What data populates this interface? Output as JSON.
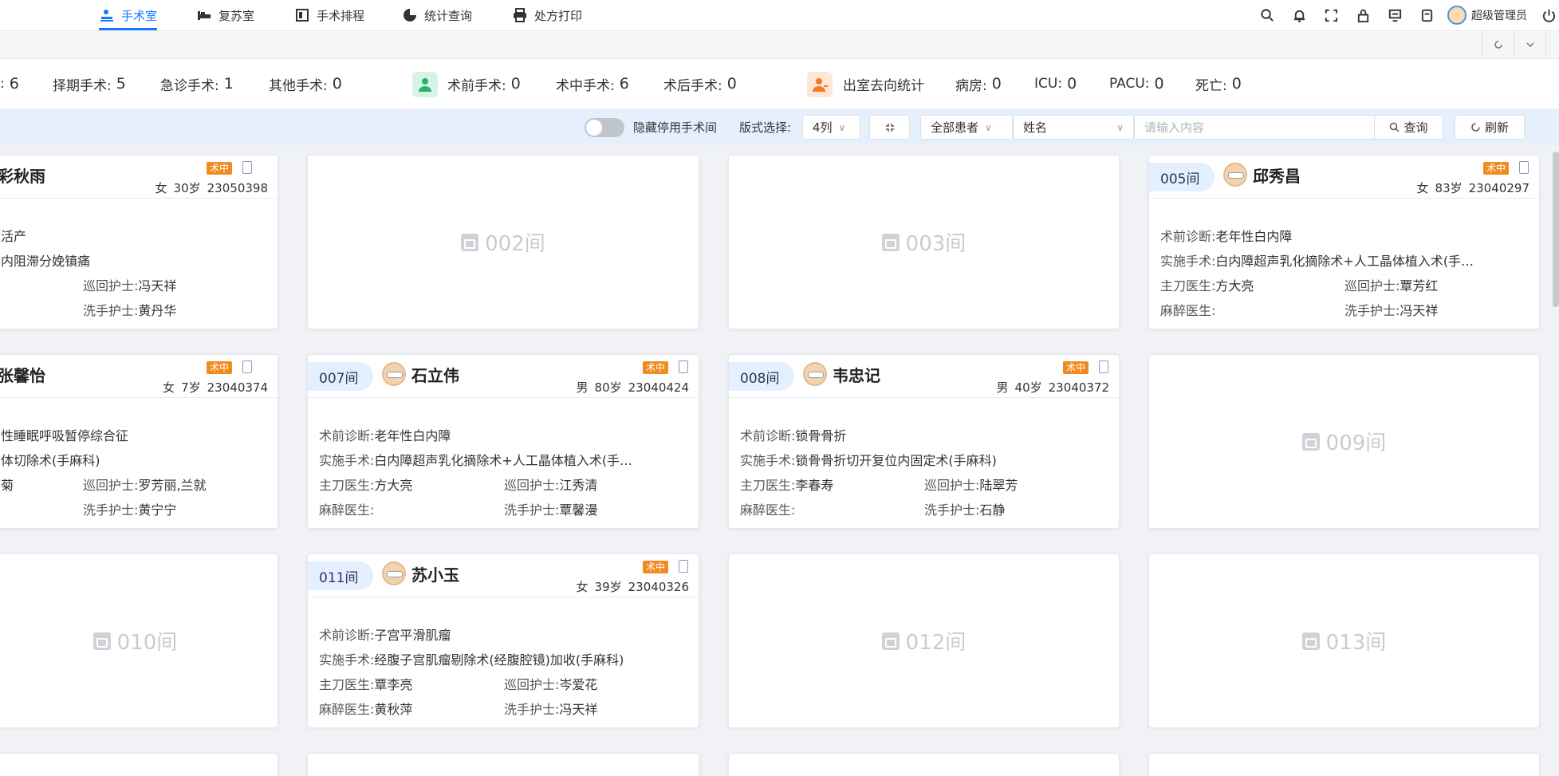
{
  "nav": {
    "tabs": [
      {
        "label": "手术室",
        "active": true,
        "icon": "operating-room-icon"
      },
      {
        "label": "复苏室",
        "active": false,
        "icon": "bed-icon"
      },
      {
        "label": "手术排程",
        "active": false,
        "icon": "schedule-icon"
      },
      {
        "label": "统计查询",
        "active": false,
        "icon": "pie-chart-icon"
      },
      {
        "label": "处方打印",
        "active": false,
        "icon": "printer-icon"
      }
    ],
    "user": "超级管理员",
    "accent": "#1677ff"
  },
  "stats": {
    "left_partial": {
      "label": ":",
      "value": "6"
    },
    "elective": {
      "label": "择期手术:",
      "value": "5"
    },
    "emergency": {
      "label": "急诊手术:",
      "value": "1"
    },
    "other": {
      "label": "其他手术:",
      "value": "0"
    },
    "pre_op": {
      "label": "术前手术:",
      "value": "0"
    },
    "intra_op": {
      "label": "术中手术:",
      "value": "6"
    },
    "post_op": {
      "label": "术后手术:",
      "value": "0"
    },
    "exit_stats": {
      "label": "出室去向统计"
    },
    "ward": {
      "label": "病房:",
      "value": "0"
    },
    "icu": {
      "label": "ICU:",
      "value": "0"
    },
    "pacu": {
      "label": "PACU:",
      "value": "0"
    },
    "death": {
      "label": "死亡:",
      "value": "0"
    }
  },
  "toolbar": {
    "hide_disabled_label": "隐藏停用手术间",
    "layout_label": "版式选择:",
    "layout_value": "4列",
    "patient_filter": "全部患者",
    "field_select": "姓名",
    "search_placeholder": "请输入内容",
    "query_button": "查询",
    "refresh_button": "刷新"
  },
  "labels": {
    "diagnosis": "术前诊断:",
    "surgery": "实施手术:",
    "surgeon": "主刀医生:",
    "anesthetist": "麻醉医生:",
    "circulating": "巡回护士:",
    "scrub": "洗手护士:",
    "status_badge": "术中"
  },
  "cards": {
    "c1": {
      "name": "彩秋雨",
      "sex": "女",
      "age": "30岁",
      "id": "23050398",
      "diagnosis": "活产",
      "surgery": "内阻滞分娩镇痛",
      "circulating": "冯天祥",
      "scrub": "黄丹华"
    },
    "c2": {
      "room": "002间"
    },
    "c3": {
      "room": "003间"
    },
    "c4": {
      "room": "005间",
      "name": "邱秀昌",
      "sex": "女",
      "age": "83岁",
      "id": "23040297",
      "diagnosis": "老年性白内障",
      "surgery": "白内障超声乳化摘除术+人工晶体植入术(手…",
      "surgeon": "方大亮",
      "anesthetist": "",
      "circulating": "覃芳红",
      "scrub": "冯天祥"
    },
    "c5": {
      "name": "张馨怡",
      "sex": "女",
      "age": "7岁",
      "id": "23040374",
      "diagnosis": "性睡眠呼吸暂停综合征",
      "surgery": "体切除术(手麻科)",
      "surgeon": "菊",
      "circulating": "罗芳丽,兰就",
      "scrub": "黄宁宁"
    },
    "c6": {
      "room": "007间",
      "name": "石立伟",
      "sex": "男",
      "age": "80岁",
      "id": "23040424",
      "diagnosis": "老年性白内障",
      "surgery": "白内障超声乳化摘除术+人工晶体植入术(手…",
      "surgeon": "方大亮",
      "anesthetist": "",
      "circulating": "江秀清",
      "scrub": "覃馨漫"
    },
    "c7": {
      "room": "008间",
      "name": "韦忠记",
      "sex": "男",
      "age": "40岁",
      "id": "23040372",
      "diagnosis": "锁骨骨折",
      "surgery": "锁骨骨折切开复位内固定术(手麻科)",
      "surgeon": "李春寿",
      "anesthetist": "",
      "circulating": "陆翠芳",
      "scrub": "石静"
    },
    "c8": {
      "room": "009间"
    },
    "c9": {
      "room": "010间"
    },
    "c10": {
      "room": "011间",
      "name": "苏小玉",
      "sex": "女",
      "age": "39岁",
      "id": "23040326",
      "diagnosis": "子宫平滑肌瘤",
      "surgery": "经腹子宫肌瘤剔除术(经腹腔镜)加收(手麻科)",
      "surgeon": "覃李亮",
      "anesthetist": "黄秋萍",
      "circulating": "岑爱花",
      "scrub": "冯天祥"
    },
    "c11": {
      "room": "012间"
    },
    "c12": {
      "room": "013间"
    }
  },
  "colors": {
    "badge": "#f08c1f",
    "room_tag": "#e4efff",
    "toolbar_bg": "#e6f0fd"
  }
}
